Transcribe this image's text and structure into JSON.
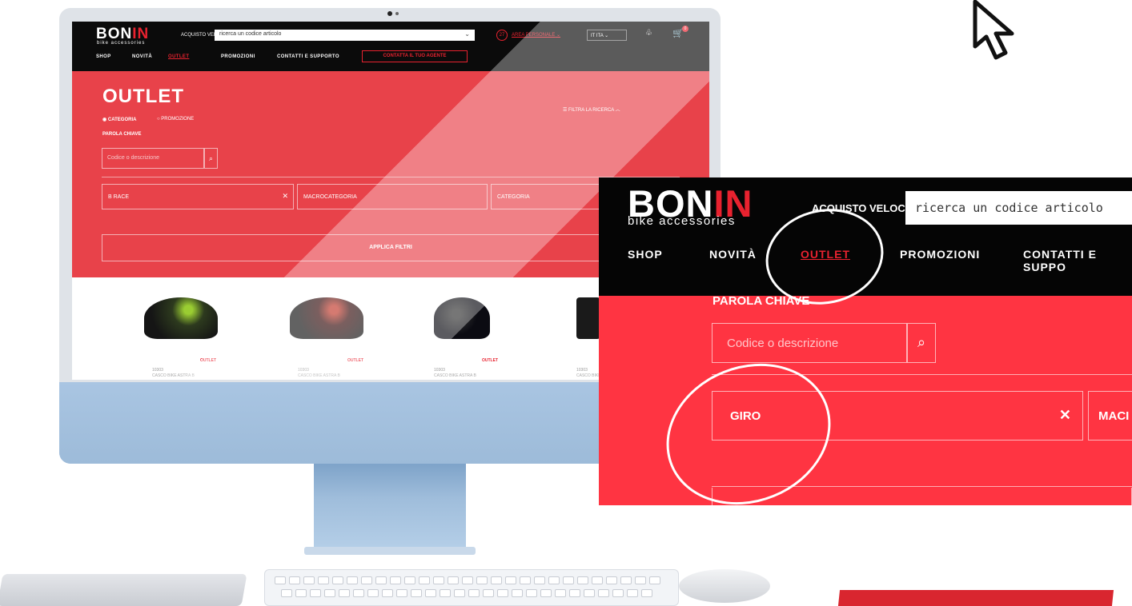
{
  "brand": {
    "name_left": "BON",
    "name_right": "IN",
    "sub": "bike accessories"
  },
  "header": {
    "quick_buy_label": "ACQUISTO VELOCE:",
    "search_placeholder": "ricerca un codice articolo",
    "area_badge": "27",
    "area_label": "AREA PERSONALE",
    "language": "IT ITA",
    "cart_count": "0"
  },
  "nav": {
    "items": [
      "SHOP",
      "NOVITÀ",
      "OUTLET",
      "PROMOZIONI",
      "CONTATTI E SUPPORTO"
    ],
    "agent_button": "CONTATTA IL TUO AGENTE",
    "zoom_last": "CONTATTI E SUPPO"
  },
  "filter_panel": {
    "title": "OUTLET",
    "filter_toggle": "FILTRA LA RICERCA",
    "radio_category": "CATEGORIA",
    "radio_promo": "PROMOZIONE",
    "keyword_label": "PAROLA CHIAVE",
    "keyword_placeholder": "Codice o descrizione",
    "brand_value_screen": "B RACE",
    "brand_value_zoom": "GIRO",
    "macro_label": "MACROCATEGORIA",
    "macro_short": "MACI",
    "category_label": "CATEGORIA",
    "apply_label": "APPLICA FILTRI"
  },
  "products": [
    {
      "tag": "OUTLET",
      "sku": "10303",
      "name": "CASCO BIKE ASTRA B",
      "color": "#2d3a1e"
    },
    {
      "tag": "OUTLET",
      "sku": "10303",
      "name": "CASCO BIKE ASTRA B",
      "color": "#3a1010"
    },
    {
      "tag": "OUTLET",
      "sku": "10303",
      "name": "CASCO BIKE ASTRA B",
      "color": "#0b0b12"
    },
    {
      "tag": "OUTLET",
      "sku": "10303",
      "name": "CASCO BIKE ASTRA B",
      "color": "#1a1a1a"
    }
  ],
  "colors": {
    "accent": "#e8222f",
    "panel_red": "#ff3442",
    "header_black": "#050505"
  }
}
